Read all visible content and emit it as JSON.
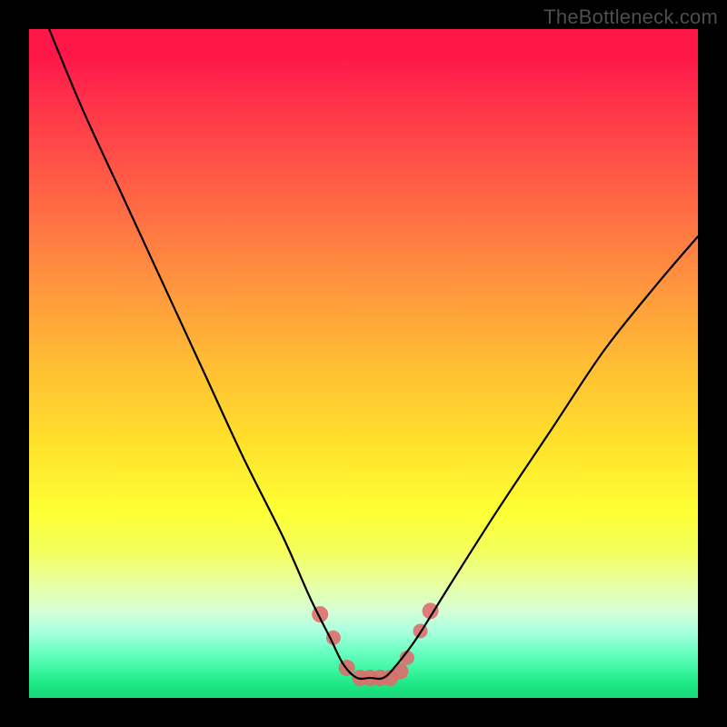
{
  "watermark": "TheBottleneck.com",
  "chart_data": {
    "type": "line",
    "title": "",
    "xlabel": "",
    "ylabel": "",
    "xlim": [
      0,
      100
    ],
    "ylim": [
      0,
      100
    ],
    "grid": false,
    "legend": false,
    "series": [
      {
        "name": "bottleneck-curve",
        "x": [
          3,
          8,
          14,
          20,
          26,
          32,
          38,
          42,
          45,
          47,
          49,
          51,
          53,
          55,
          58,
          63,
          70,
          78,
          86,
          94,
          100
        ],
        "y": [
          100,
          88,
          75,
          62,
          49,
          36,
          24,
          15,
          9,
          5,
          3,
          3,
          3,
          5,
          9,
          17,
          28,
          40,
          52,
          62,
          69
        ]
      }
    ],
    "markers": {
      "name": "highlight-points",
      "x": [
        43.5,
        45.5,
        47.5,
        49.5,
        51.0,
        52.5,
        54.0,
        55.5,
        56.5,
        58.5,
        60.0
      ],
      "y": [
        12.5,
        9.0,
        4.5,
        3.0,
        3.0,
        3.0,
        3.0,
        4.0,
        6.0,
        10.0,
        13.0
      ],
      "radius": [
        9,
        8,
        9,
        9,
        9,
        9,
        9,
        9,
        8,
        8,
        9
      ]
    },
    "background_gradient_stops": [
      {
        "pct": 0,
        "color": "#ff1749"
      },
      {
        "pct": 50,
        "color": "#ffbd34"
      },
      {
        "pct": 78,
        "color": "#f4ff5c"
      },
      {
        "pct": 100,
        "color": "#16d97a"
      }
    ]
  }
}
